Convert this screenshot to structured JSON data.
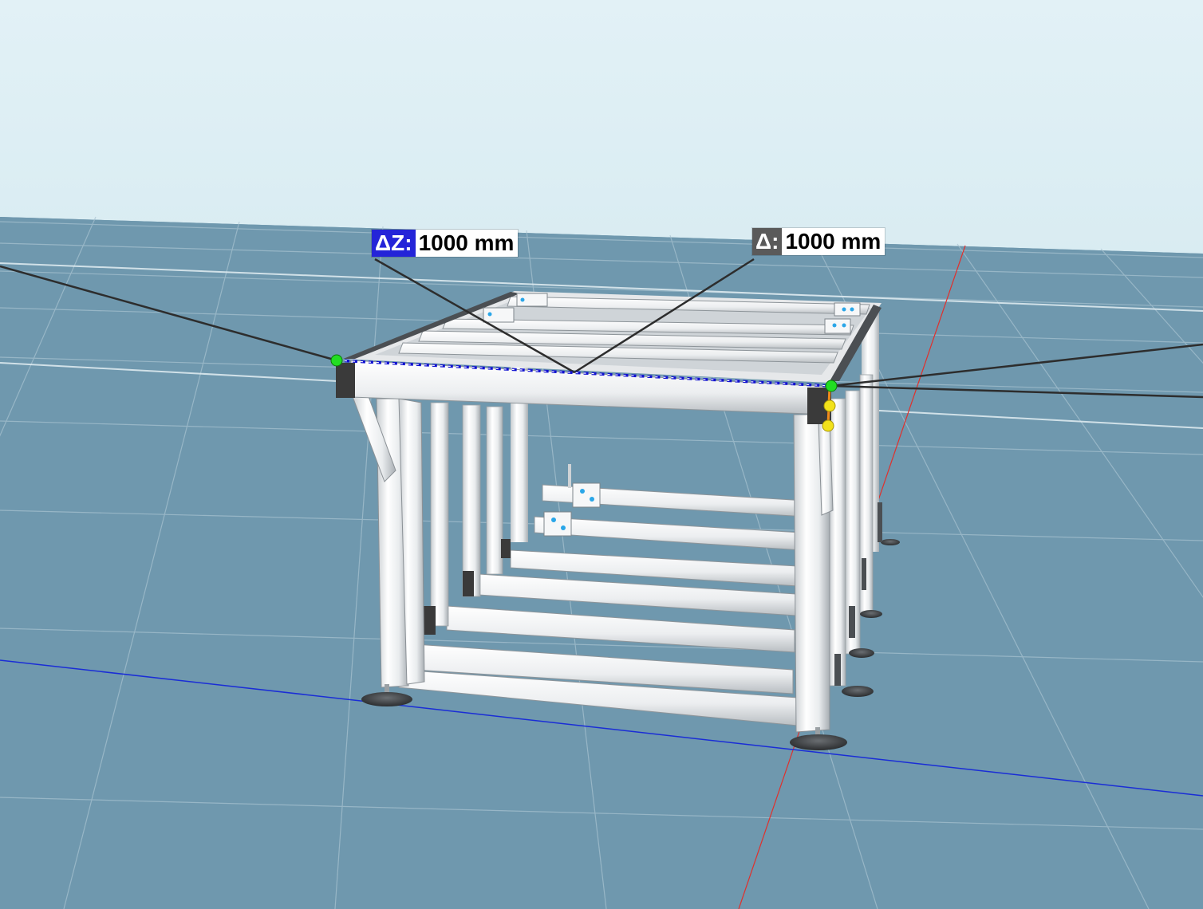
{
  "viewport": {
    "sky_colors": [
      "#e2f1f6",
      "#d9ecf2"
    ],
    "ground_color": "#6f98ae",
    "grid_color": "#a9c3d1",
    "axis_x_color": "#e0302c",
    "axis_y_color": "#1a2dd6"
  },
  "measurements": [
    {
      "id": "dz",
      "prefix": "ΔZ:",
      "value": "1000 mm",
      "prefix_color": "#2424d8"
    },
    {
      "id": "d",
      "prefix": "Δ:",
      "value": "1000 mm",
      "prefix_color": "#5a5a5a"
    }
  ],
  "model": {
    "name": "aluminum-profile-frame",
    "profile_color": "#f1f2f3",
    "endcap_color": "#3a3a3a",
    "bracket_accent": "#2aa6e8"
  },
  "snap_points": {
    "endpoint_color": "#22dd22",
    "handle_color": "#f2e21a",
    "measure_line_color": "#1010d0"
  }
}
